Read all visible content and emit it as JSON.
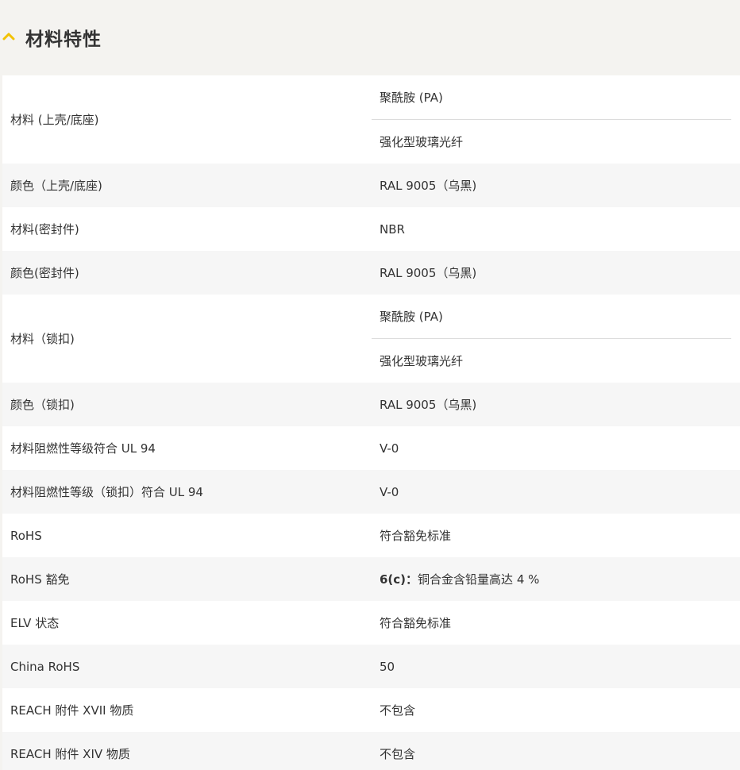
{
  "section": {
    "title": "材料特性",
    "accent_color": "#f2c200",
    "icon": "chevron-up-icon"
  },
  "rows": [
    {
      "label": "材料 (上壳/底座)",
      "values": [
        "聚酰胺 (PA)",
        "强化型玻璃光纤"
      ]
    },
    {
      "label": "颜色（上壳/底座)",
      "values": [
        "RAL 9005（乌黑)"
      ]
    },
    {
      "label": "材料(密封件)",
      "values": [
        "NBR"
      ]
    },
    {
      "label": "颜色(密封件)",
      "values": [
        "RAL 9005（乌黑)"
      ]
    },
    {
      "label": "材料（锁扣)",
      "values": [
        "聚酰胺 (PA)",
        "强化型玻璃光纤"
      ]
    },
    {
      "label": "颜色（锁扣)",
      "values": [
        "RAL 9005（乌黑)"
      ]
    },
    {
      "label": "材料阻燃性等级符合 UL 94",
      "values": [
        "V-0"
      ]
    },
    {
      "label": "材料阻燃性等级（锁扣）符合 UL 94",
      "values": [
        "V-0"
      ]
    },
    {
      "label": "RoHS",
      "values": [
        "符合豁免标准"
      ]
    },
    {
      "label": "RoHS 豁免",
      "value_prefix": "6(c)：",
      "values": [
        "铜合金含铅量高达 4 %"
      ]
    },
    {
      "label": "ELV 状态",
      "values": [
        "符合豁免标准"
      ]
    },
    {
      "label": "China RoHS",
      "values": [
        "50"
      ]
    },
    {
      "label": "REACH 附件 XVII 物质",
      "values": [
        "不包含"
      ]
    },
    {
      "label": "REACH 附件 XIV 物质",
      "values": [
        "不包含"
      ]
    }
  ]
}
